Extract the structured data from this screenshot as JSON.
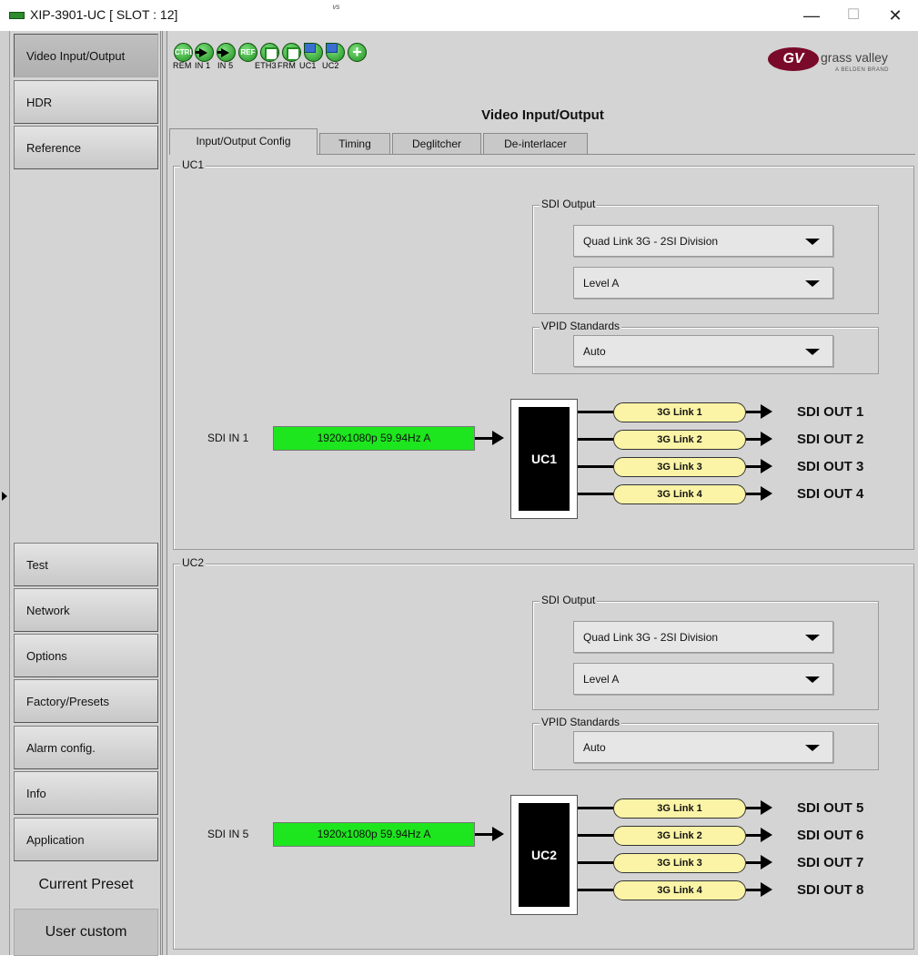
{
  "window": {
    "title": "XIP-3901-UC [ SLOT : 12]",
    "corner_mark": "ᵛˢ",
    "minimize": "—",
    "maximize": "☐",
    "close": "✕"
  },
  "sidebar": {
    "items": [
      {
        "label": "Video Input/Output",
        "active": true
      },
      {
        "label": "HDR"
      },
      {
        "label": "Reference"
      },
      {
        "label": "Test"
      },
      {
        "label": "Network"
      },
      {
        "label": "Options"
      },
      {
        "label": "Factory/Presets"
      },
      {
        "label": "Alarm config."
      },
      {
        "label": "Info"
      },
      {
        "label": "Application"
      }
    ],
    "preset_label": "Current Preset",
    "preset_value": "User custom"
  },
  "status_icons": [
    {
      "icon": "ctrl-icon",
      "text": "CTRL",
      "label": "REM"
    },
    {
      "icon": "input-arrow-icon",
      "label": "IN 1"
    },
    {
      "icon": "input-arrow-icon",
      "label": "IN 5"
    },
    {
      "icon": "ref-icon",
      "text": "REF",
      "label": ""
    },
    {
      "icon": "ethernet-icon",
      "label": "ETH3"
    },
    {
      "icon": "frame-network-icon",
      "label": "FRM"
    },
    {
      "icon": "uc-output-icon",
      "label": "UC1"
    },
    {
      "icon": "uc-output-icon",
      "label": "UC2"
    },
    {
      "icon": "plus-icon",
      "label": ""
    }
  ],
  "logo": {
    "symbol": "GV",
    "brand": "grass valley",
    "sub": "A BELDEN BRAND"
  },
  "page_title": "Video Input/Output",
  "tabs": [
    "Input/Output Config",
    "Timing",
    "Deglitcher",
    "De-interlacer"
  ],
  "active_tab": "Input/Output Config",
  "uc_sections": [
    {
      "name": "UC1",
      "sdi_output_label": "SDI Output",
      "sdi_output_mode": "Quad Link 3G - 2SI Division",
      "sdi_output_level": "Level A",
      "vpid_label": "VPID Standards",
      "vpid_value": "Auto",
      "input_label": "SDI IN 1",
      "input_format": "1920x1080p 59.94Hz A",
      "block_label": "UC1",
      "links": [
        "3G Link 1",
        "3G Link 2",
        "3G Link 3",
        "3G Link 4"
      ],
      "outputs": [
        "SDI OUT 1",
        "SDI OUT 2",
        "SDI OUT 3",
        "SDI OUT 4"
      ]
    },
    {
      "name": "UC2",
      "sdi_output_label": "SDI Output",
      "sdi_output_mode": "Quad Link 3G - 2SI Division",
      "sdi_output_level": "Level A",
      "vpid_label": "VPID Standards",
      "vpid_value": "Auto",
      "input_label": "SDI IN 5",
      "input_format": "1920x1080p 59.94Hz A",
      "block_label": "UC2",
      "links": [
        "3G Link 1",
        "3G Link 2",
        "3G Link 3",
        "3G Link 4"
      ],
      "outputs": [
        "SDI OUT 5",
        "SDI OUT 6",
        "SDI OUT 7",
        "SDI OUT 8"
      ]
    }
  ],
  "colors": {
    "input_ok": "#1ee61e",
    "link_pill": "#fbf4a6",
    "status_green": "#1e8f1e",
    "logo": "#7a0a2a"
  }
}
